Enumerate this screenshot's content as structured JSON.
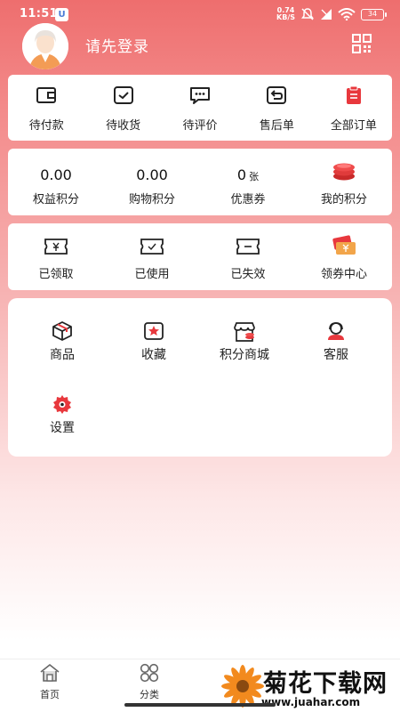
{
  "status_bar": {
    "time": "11:51",
    "app_badge": "U",
    "net_speed": "0.74",
    "net_unit": "KB/S",
    "battery": "34"
  },
  "header": {
    "login_text": "请先登录"
  },
  "orders": [
    {
      "label": "待付款",
      "icon": "wallet-icon"
    },
    {
      "label": "待收货",
      "icon": "box-check-icon"
    },
    {
      "label": "待评价",
      "icon": "chat-bubble-icon"
    },
    {
      "label": "售后单",
      "icon": "return-icon"
    },
    {
      "label": "全部订单",
      "icon": "clipboard-icon"
    }
  ],
  "points": [
    {
      "value": "0.00",
      "unit": "",
      "label": "权益积分"
    },
    {
      "value": "0.00",
      "unit": "",
      "label": "购物积分"
    },
    {
      "value": "0",
      "unit": "张",
      "label": "优惠券"
    },
    {
      "value": "",
      "unit": "",
      "label": "我的积分",
      "icon": "coin-stack-icon"
    }
  ],
  "coupons": [
    {
      "label": "已领取",
      "icon": "coupon-yen-icon"
    },
    {
      "label": "已使用",
      "icon": "coupon-used-icon"
    },
    {
      "label": "已失效",
      "icon": "coupon-expired-icon"
    },
    {
      "label": "领券中心",
      "icon": "coupon-center-icon"
    }
  ],
  "services": [
    {
      "label": "商品",
      "icon": "package-icon"
    },
    {
      "label": "收藏",
      "icon": "star-box-icon"
    },
    {
      "label": "积分商城",
      "icon": "store-icon"
    },
    {
      "label": "客服",
      "icon": "headset-icon"
    },
    {
      "label": "设置",
      "icon": "gear-icon"
    }
  ],
  "tabbar": [
    {
      "label": "首页",
      "icon": "home-icon"
    },
    {
      "label": "分类",
      "icon": "category-icon"
    }
  ],
  "watermark": {
    "title": "菊花下载网",
    "url": "www.juahar.com"
  },
  "colors": {
    "accent": "#e8383d",
    "gradient_top": "#ee6e6e"
  }
}
